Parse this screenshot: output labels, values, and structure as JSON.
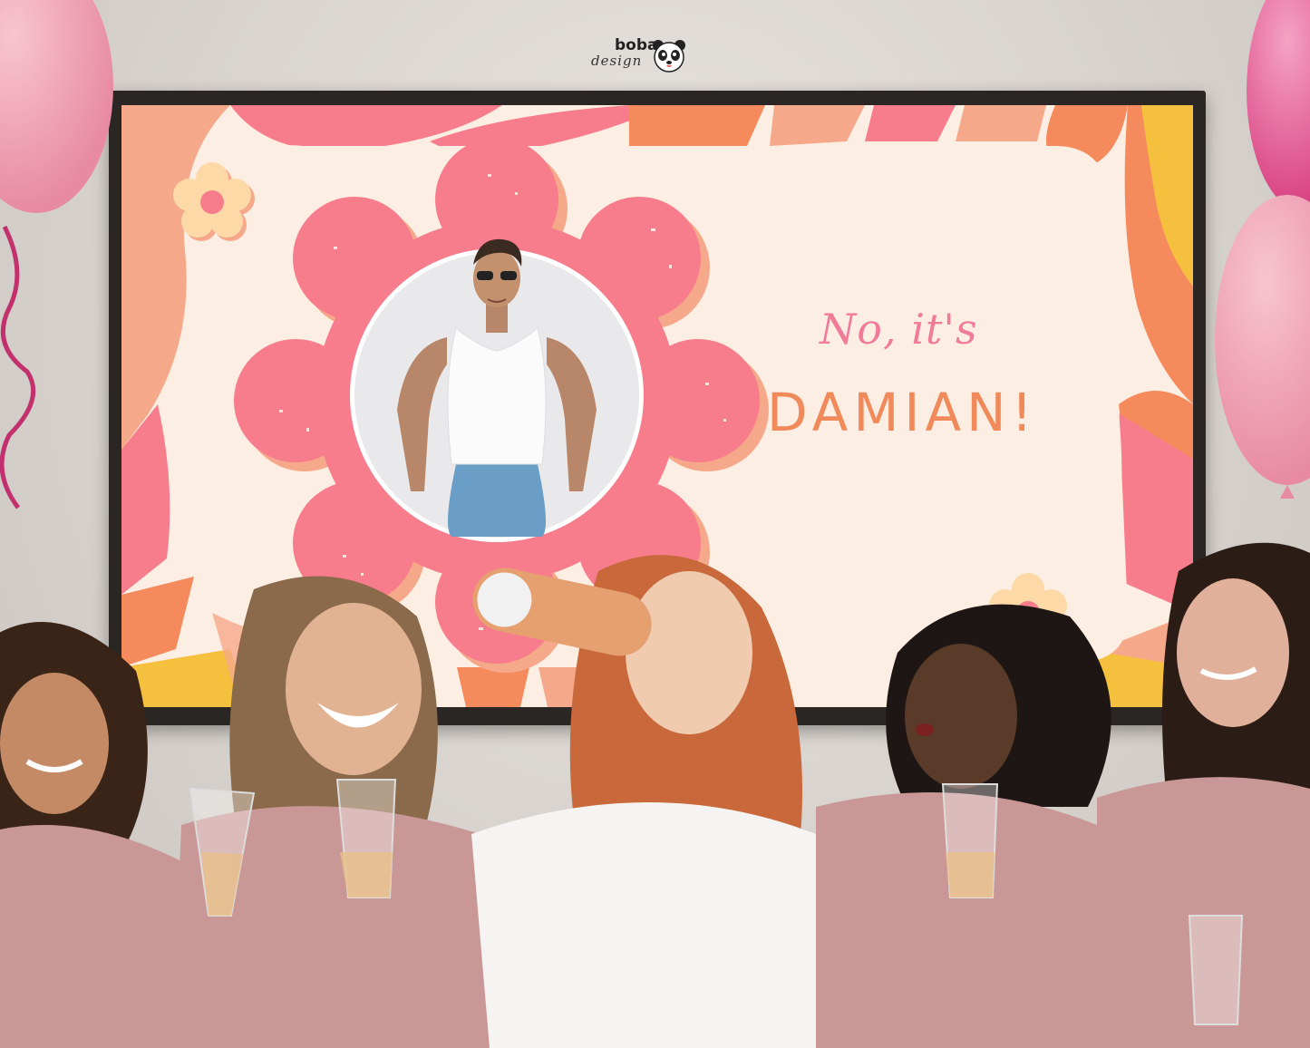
{
  "brand": {
    "name": "boba",
    "tagline": "design",
    "icon": "panda-icon"
  },
  "slide": {
    "line1": "No, it's",
    "line2": "DAMIAN!"
  },
  "colors": {
    "pink": "#f77d8c",
    "peach": "#f6a98a",
    "orange": "#f58a5c",
    "yellow": "#f6c03f",
    "cream": "#fdeee3",
    "robe": "#c99896"
  }
}
